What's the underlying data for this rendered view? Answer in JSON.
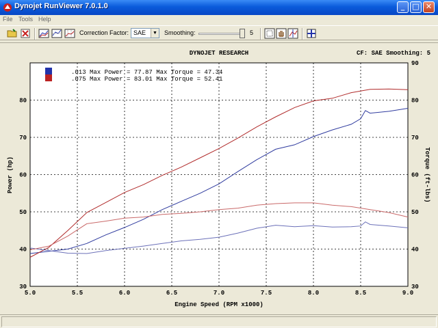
{
  "window": {
    "title": "Dynojet RunViewer 7.0.1.0",
    "min_glyph": "_",
    "max_glyph": "□",
    "close_glyph": "✕"
  },
  "menu": [
    "File",
    "Tools",
    "Help"
  ],
  "toolbar": {
    "correction_label": "Correction Factor:",
    "correction_value": "SAE",
    "smoothing_label": "Smoothing:",
    "smoothing_value": "5",
    "smoothing_level": 5
  },
  "chart_header": {
    "title": "DYNOJET RESEARCH",
    "info": "CF: SAE  Smoothing: 5"
  },
  "legend": [
    {
      "text": ".013 Max Power = 77.87 Max Torque = 47.34",
      "color": "#2233AA"
    },
    {
      "text": ".075 Max Power = 83.01 Max Torque = 52.41",
      "color": "#BB2222"
    }
  ],
  "colors": {
    "run1": "#2E3A9E",
    "run2": "#B02A2A",
    "run1_torque": "#6A6FB8",
    "run2_torque": "#C96868",
    "plot_bg": "#FFFFFF"
  },
  "chart_data": {
    "type": "line",
    "xlabel": "Engine Speed (RPM x1000)",
    "ylabel": "Power (hp)",
    "y2label": "Torque (ft-lbs)",
    "xlim": [
      5.0,
      9.0
    ],
    "ylim": [
      30,
      90
    ],
    "y2lim": [
      30,
      90
    ],
    "x_ticks": [
      "5.0",
      "5.5",
      "6.0",
      "6.5",
      "7.0",
      "7.5",
      "8.0",
      "8.5",
      "9.0"
    ],
    "y_ticks": [
      "30",
      "40",
      "50",
      "60",
      "70",
      "80"
    ],
    "y2_ticks": [
      "30",
      "40",
      "50",
      "60",
      "70",
      "80",
      "90"
    ],
    "grid": true,
    "series": [
      {
        "name": ".013 Power",
        "axis": "left",
        "color_key": "run1",
        "x": [
          5.0,
          5.2,
          5.4,
          5.6,
          5.8,
          6.0,
          6.2,
          6.4,
          6.6,
          6.8,
          7.0,
          7.2,
          7.4,
          7.6,
          7.8,
          8.0,
          8.2,
          8.4,
          8.5,
          8.55,
          8.6,
          8.8,
          9.0
        ],
        "y": [
          38.8,
          39.4,
          40.0,
          41.5,
          43.8,
          45.8,
          48.0,
          50.6,
          52.8,
          55.0,
          57.5,
          60.8,
          64.0,
          66.8,
          68.0,
          70.2,
          72.0,
          73.5,
          75.0,
          77.2,
          76.5,
          77.0,
          77.8
        ]
      },
      {
        "name": ".075 Power",
        "axis": "left",
        "color_key": "run2",
        "x": [
          5.0,
          5.2,
          5.4,
          5.6,
          5.8,
          6.0,
          6.2,
          6.4,
          6.6,
          6.8,
          7.0,
          7.2,
          7.4,
          7.6,
          7.8,
          8.0,
          8.2,
          8.4,
          8.6,
          8.8,
          9.0
        ],
        "y": [
          37.8,
          40.5,
          45.0,
          49.8,
          52.5,
          55.2,
          57.3,
          59.8,
          62.0,
          64.5,
          67.0,
          69.8,
          72.8,
          75.5,
          78.0,
          79.8,
          80.5,
          82.0,
          82.9,
          83.0,
          82.8
        ]
      },
      {
        "name": ".013 Torque",
        "axis": "right",
        "color_key": "run1_torque",
        "x": [
          5.0,
          5.2,
          5.4,
          5.6,
          5.8,
          6.0,
          6.2,
          6.4,
          6.6,
          6.8,
          7.0,
          7.2,
          7.4,
          7.6,
          7.8,
          8.0,
          8.2,
          8.4,
          8.5,
          8.55,
          8.6,
          8.8,
          9.0
        ],
        "y": [
          40.3,
          39.6,
          38.9,
          38.8,
          39.6,
          40.2,
          40.8,
          41.5,
          42.2,
          42.6,
          43.2,
          44.3,
          45.6,
          46.4,
          46.0,
          46.3,
          45.9,
          46.0,
          46.2,
          47.3,
          46.6,
          46.2,
          45.7
        ]
      },
      {
        "name": ".075 Torque",
        "axis": "right",
        "color_key": "run2_torque",
        "x": [
          5.0,
          5.2,
          5.4,
          5.6,
          5.8,
          6.0,
          6.2,
          6.4,
          6.6,
          6.8,
          7.0,
          7.2,
          7.4,
          7.6,
          7.8,
          8.0,
          8.2,
          8.4,
          8.6,
          8.8,
          9.0
        ],
        "y": [
          39.8,
          40.8,
          43.5,
          46.8,
          47.5,
          48.3,
          48.6,
          49.3,
          49.6,
          50.0,
          50.6,
          51.0,
          51.8,
          52.2,
          52.4,
          52.4,
          51.8,
          51.4,
          50.6,
          49.8,
          48.6
        ]
      }
    ]
  }
}
